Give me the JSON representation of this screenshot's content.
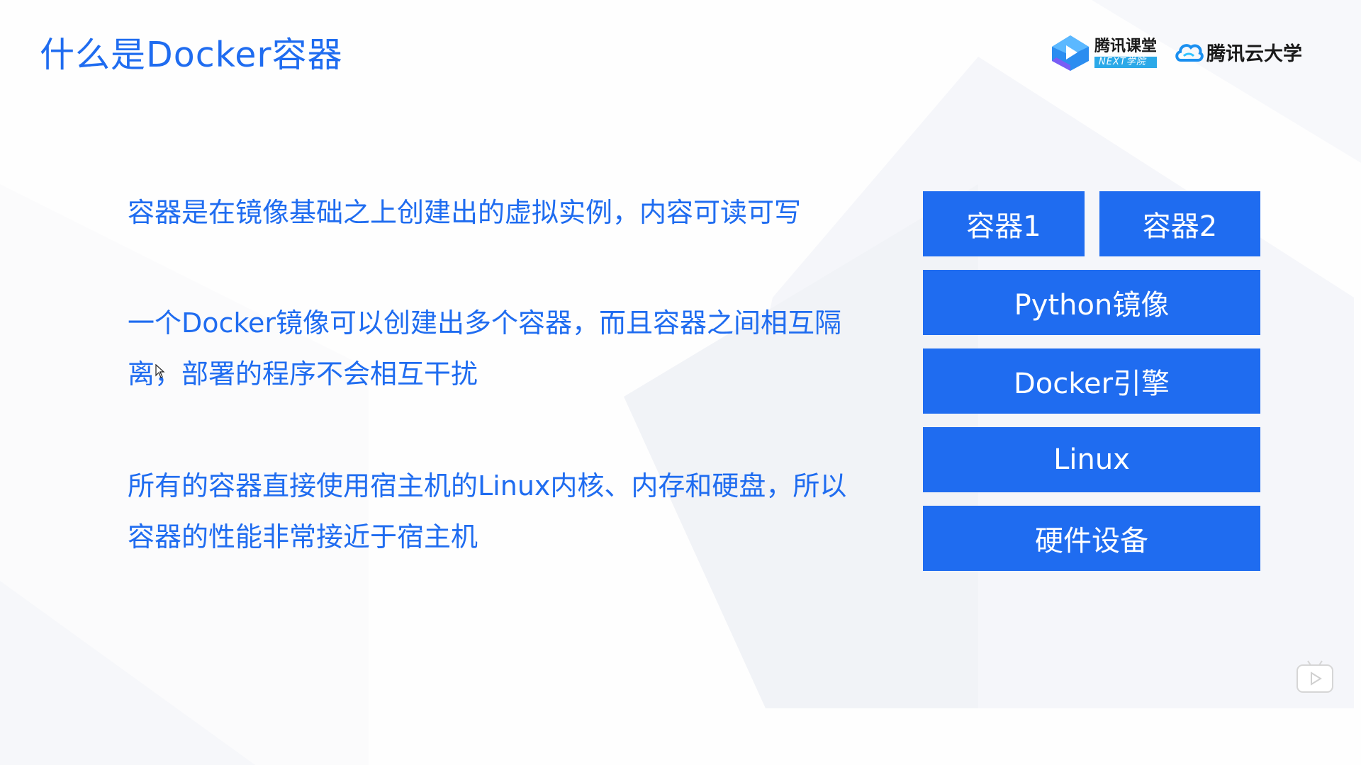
{
  "title": "什么是Docker容器",
  "logos": {
    "ketang_name": "腾讯课堂",
    "ketang_sub": "NEXT学院",
    "cloud_name": "腾讯云大学"
  },
  "paragraphs": {
    "p1": "容器是在镜像基础之上创建出的虚拟实例，内容可读可写",
    "p2": "一个Docker镜像可以创建出多个容器，而且容器之间相互隔离，部署的程序不会相互干扰",
    "p3": "所有的容器直接使用宿主机的Linux内核、内存和硬盘，所以容器的性能非常接近于宿主机"
  },
  "stack": {
    "container1": "容器1",
    "container2": "容器2",
    "image": "Python镜像",
    "engine": "Docker引擎",
    "os": "Linux",
    "hardware": "硬件设备"
  },
  "colors": {
    "accent": "#1f6cf0",
    "background": "#fefefe",
    "decor": "#f3f4f8"
  },
  "icons": {
    "ketang_logo": "tencent-classroom-logo-icon",
    "cloud_logo": "tencent-cloud-logo-icon",
    "cursor": "mouse-cursor-icon",
    "player": "video-play-icon"
  }
}
